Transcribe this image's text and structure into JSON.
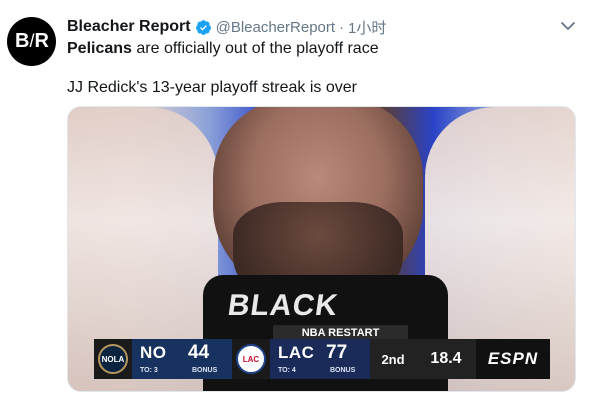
{
  "tweet": {
    "avatar_text_left": "B",
    "avatar_text_sep": "/",
    "avatar_text_right": "R",
    "author_name": "Bleacher Report",
    "handle": "@BleacherReport",
    "separator": "·",
    "time": "1小时",
    "line1_bold": "Pelicans",
    "line1_rest": " are officially out of the playoff race",
    "line2": "JJ Redick's 13-year playoff streak is over"
  },
  "media": {
    "shirt_text": "BLACK",
    "score_label": "NBA RESTART",
    "home": {
      "logo_text": "NOLA",
      "abbr": "NO",
      "points": "44",
      "timeouts": "TO: 3",
      "bonus": "BONUS"
    },
    "away": {
      "logo_text": "LAC",
      "abbr": "LAC",
      "points": "77",
      "timeouts": "TO: 4",
      "bonus": "BONUS"
    },
    "period": "2nd",
    "clock": "18.4",
    "network": "ESPN"
  },
  "colors": {
    "verified": "#1da1f2",
    "secondary_text": "#657786",
    "home_team": "#17325e",
    "away_team": "#1a2b5a"
  },
  "icons": {
    "verified": "verified-badge-icon",
    "menu": "chevron-down-icon"
  }
}
